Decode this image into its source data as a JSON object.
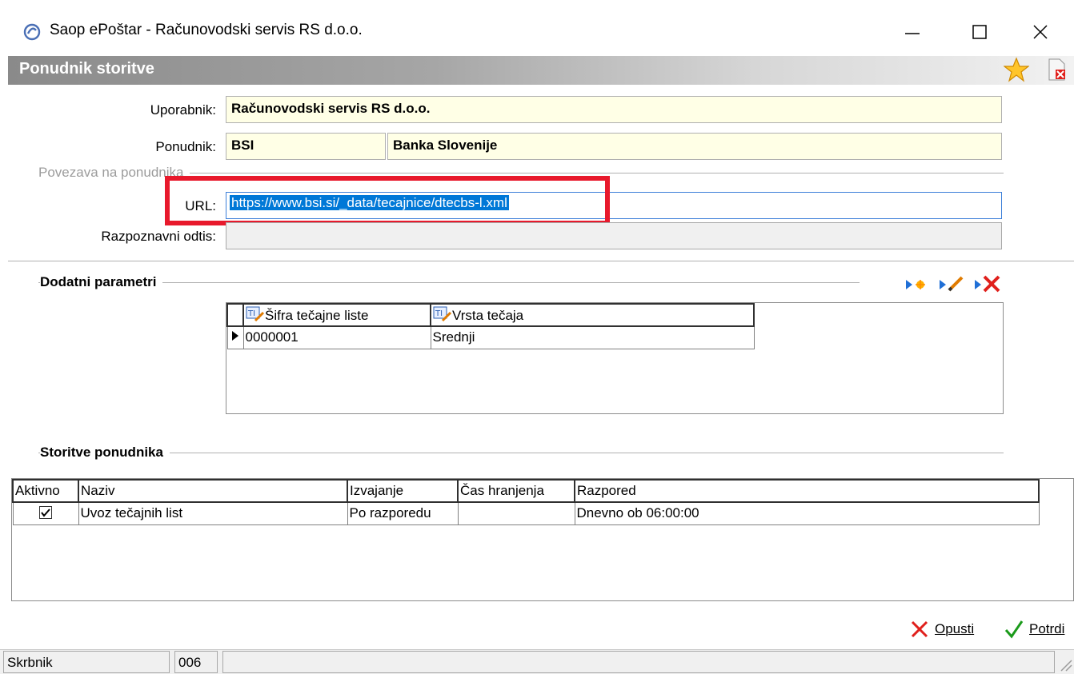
{
  "window": {
    "title": "Saop ePoštar - Računovodski servis RS d.o.o."
  },
  "header": {
    "title": "Ponudnik storitve"
  },
  "form": {
    "user_label": "Uporabnik:",
    "user_value": "Računovodski servis RS d.o.o.",
    "provider_label": "Ponudnik:",
    "provider_code": "BSI",
    "provider_name": "Banka Slovenije",
    "link_group": "Povezava na ponudnika",
    "url_label": "URL:",
    "url_value": "https://www.bsi.si/_data/tecajnice/dtecbs-l.xml",
    "fingerprint_label": "Razpoznavni odtis:"
  },
  "params": {
    "title": "Dodatni parametri",
    "columns": [
      "Šifra tečajne liste",
      "Vrsta tečaja"
    ],
    "rows": [
      [
        "0000001",
        "Srednji"
      ]
    ]
  },
  "services": {
    "title": "Storitve ponudnika",
    "columns": [
      "Aktivno",
      "Naziv",
      "Izvajanje",
      "Čas hranjenja",
      "Razpored"
    ],
    "rows": [
      {
        "active": true,
        "name": "Uvoz tečajnih list",
        "execution": "Po razporedu",
        "retention": "",
        "schedule": "Dnevno ob 06:00:00"
      }
    ]
  },
  "buttons": {
    "cancel_label": "Opusti",
    "confirm_label": "Potrdi"
  },
  "status": {
    "user": "Skrbnik",
    "code": "006"
  },
  "colors": {
    "highlight_box": "#e8192c",
    "field_bg": "#ffffe6",
    "selection": "#0078d7"
  }
}
